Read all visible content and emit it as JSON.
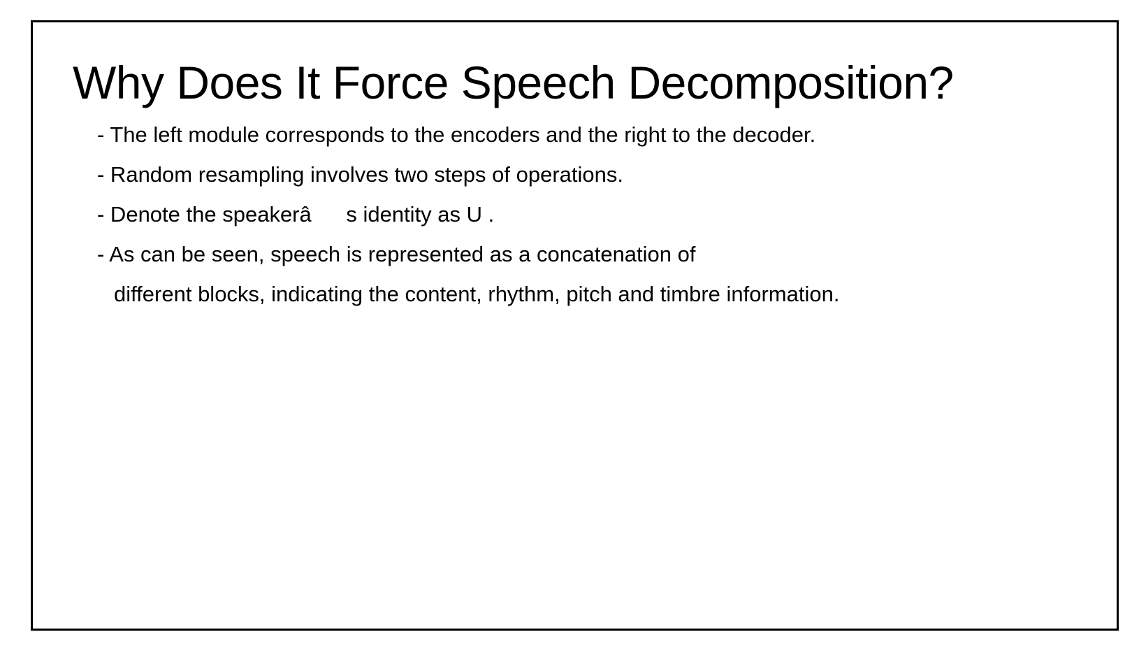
{
  "slide": {
    "title": "Why Does It Force Speech Decomposition?",
    "bullets": [
      "- The left module corresponds to the encoders and the right to the decoder.",
      "- Random resampling involves two steps of operations.",
      "- Denote the speakerâs identity as U .",
      "- As can be seen, speech is represented as a concatenation of"
    ],
    "bullet_continuation": "different blocks, indicating the content, rhythm, pitch and timbre information."
  }
}
